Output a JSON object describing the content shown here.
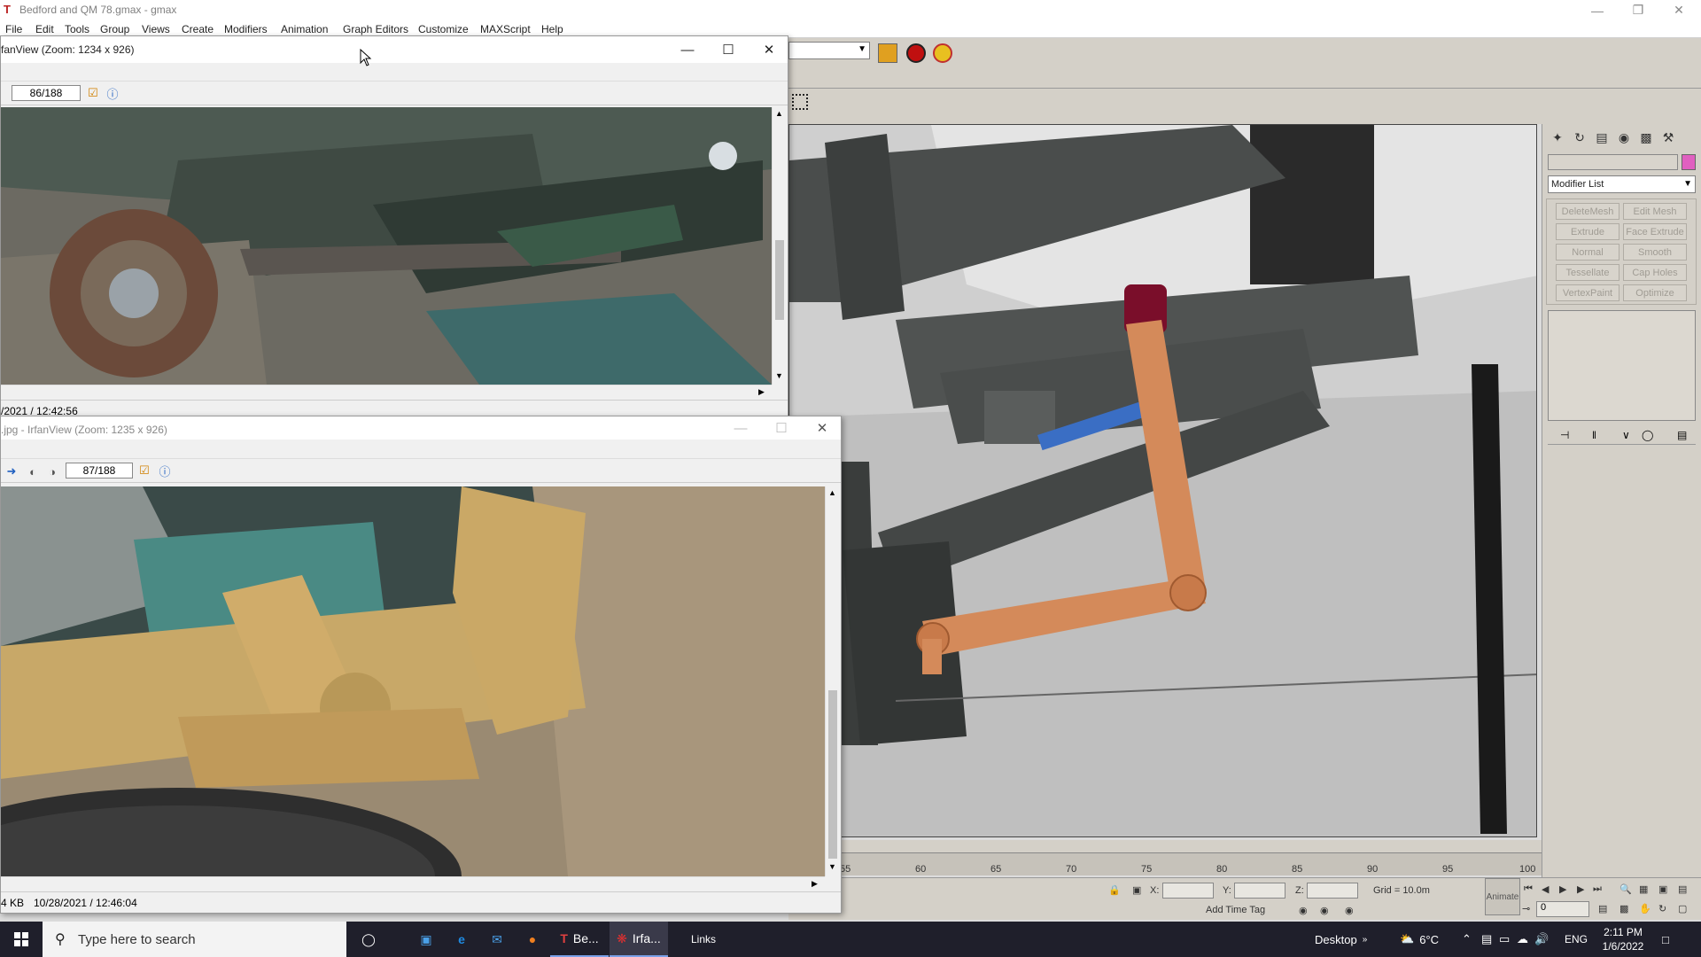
{
  "gmax": {
    "title": "Bedford and QM 78.gmax - gmax",
    "menu": [
      "File",
      "Edit",
      "Tools",
      "Group",
      "Views",
      "Create",
      "Modifiers",
      "Animation",
      "Graph Editors",
      "Customize",
      "MAXScript",
      "Help"
    ],
    "modifier_list_label": "Modifier List",
    "modifier_buttons": [
      "DeleteMesh",
      "Edit Mesh",
      "Extrude",
      "Face Extrude",
      "Normal",
      "Smooth",
      "Tessellate",
      "Cap Holes",
      "VertexPaint",
      "Optimize"
    ],
    "ruler_ticks": [
      "55",
      "60",
      "65",
      "70",
      "75",
      "80",
      "85",
      "90",
      "95",
      "100"
    ],
    "coord_labels": {
      "x": "X:",
      "y": "Y:",
      "z": "Z:"
    },
    "grid_label": "Grid = 10.0m",
    "add_time_tag": "Add Time Tag",
    "animate_label": "Animate",
    "frame_field": "0"
  },
  "irfan1": {
    "title": "fanView (Zoom: 1234 x 926)",
    "counter": "86/188",
    "status_date": "/2021 / 12:42:56"
  },
  "irfan2": {
    "title": ".jpg - IrfanView (Zoom: 1235 x 926)",
    "counter": "87/188",
    "status_size": "4 KB",
    "status_date": "10/28/2021 / 12:46:04"
  },
  "taskbar": {
    "search_placeholder": "Type here to search",
    "app_gmax": "Be...",
    "app_irfan": "Irfa...",
    "links": "Links",
    "desktop": "Desktop",
    "temperature": "6°C",
    "language": "ENG",
    "time": "2:11 PM",
    "date": "1/6/2022"
  },
  "colors": {
    "arm_orange": "#d48a5a",
    "axle_grey": "#4a4d4c",
    "shock_maroon": "#7a0e2a",
    "rod_blue": "#3a6ec4",
    "taskbar_bg": "#1f1f2b"
  }
}
